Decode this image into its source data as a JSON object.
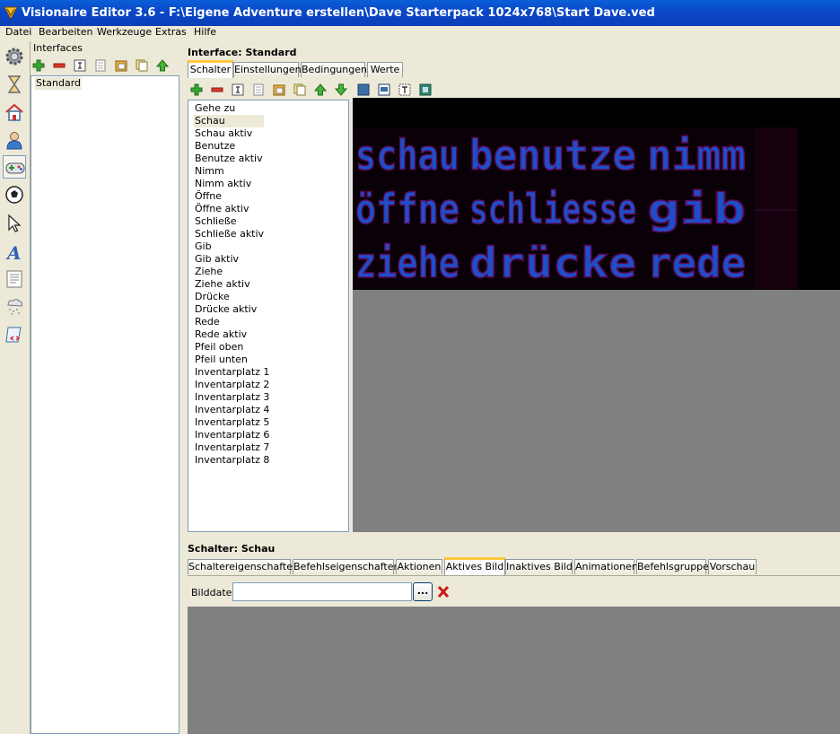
{
  "window": {
    "title": "Visionaire Editor 3.6 - F:\\Eigene Adventure erstellen\\Dave Starterpack 1024x768\\Start Dave.ved"
  },
  "menu": {
    "items": [
      "Datei",
      "Bearbeiten",
      "Werkzeuge",
      "Extras",
      "Hilfe"
    ]
  },
  "leftbar": {
    "icons": [
      "gear-icon",
      "hourglass-icon",
      "house-icon",
      "person-icon",
      "gamepad-icon",
      "ball-icon",
      "pointer-icon",
      "font-icon",
      "text-document-icon",
      "particles-icon",
      "script-icon"
    ],
    "active": "gamepad-icon"
  },
  "interfaces": {
    "title": "Interfaces",
    "items": [
      "Standard"
    ],
    "toolbar_icons": [
      "add-icon",
      "remove-icon",
      "rename-icon",
      "copy-icon",
      "paste-icon",
      "duplicate-icon",
      "move-up-icon"
    ]
  },
  "interface": {
    "title": "Interface: Standard",
    "tabs": [
      "Schalter",
      "Einstellungen",
      "Bedingungen",
      "Werte"
    ],
    "active_tab": "Schalter",
    "toolbar_icons": [
      "add-icon",
      "remove-icon",
      "rename-icon",
      "copy-icon",
      "paste-icon",
      "duplicate-icon",
      "move-up-icon",
      "move-down-icon",
      "select-area-icon",
      "edit-area-icon",
      "text-area-icon",
      "center-icon"
    ],
    "buttons": [
      "Gehe zu",
      "Schau",
      "Schau aktiv",
      "Benutze",
      "Benutze aktiv",
      "Nimm",
      "Nimm aktiv",
      "Öffne",
      "Öffne aktiv",
      "Schließe",
      "Schließe aktiv",
      "Gib",
      "Gib aktiv",
      "Ziehe",
      "Ziehe aktiv",
      "Drücke",
      "Drücke aktiv",
      "Rede",
      "Rede aktiv",
      "Pfeil oben",
      "Pfeil unten",
      "Inventarplatz 1",
      "Inventarplatz 2",
      "Inventarplatz 3",
      "Inventarplatz 4",
      "Inventarplatz 5",
      "Inventarplatz 6",
      "Inventarplatz 7",
      "Inventarplatz 8"
    ],
    "selected_button": "Schau",
    "sprite_words": [
      "schau",
      "benutze",
      "nimm",
      "öffne",
      "schliesse",
      "gib",
      "ziehe",
      "drücke",
      "rede"
    ]
  },
  "button_panel": {
    "title": "Schalter: Schau",
    "tabs": [
      "Schaltereigenschaften",
      "Befehlseigenschaften",
      "Aktionen",
      "Aktives Bild",
      "Inaktives Bild",
      "Animationen",
      "Befehlsgruppe",
      "Vorschau"
    ],
    "active_tab": "Aktives Bild",
    "file_label": "Bilddatei",
    "file_value": "",
    "browse_label": "...",
    "colors": {
      "sprite_text": "#1e4fc8",
      "sprite_shadow": "#5a0a5a",
      "sprite_bg": "#000000",
      "preview_bg": "#808080",
      "accent_tab": "#ffc83c"
    }
  }
}
